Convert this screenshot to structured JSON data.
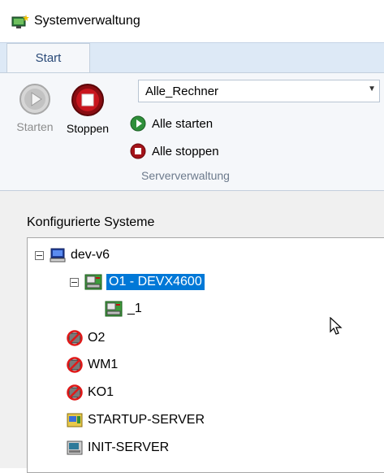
{
  "window": {
    "title": "Systemverwaltung",
    "icon": "monitor-star-icon"
  },
  "ribbon": {
    "tab": "Start",
    "starten_label": "Starten",
    "stoppen_label": "Stoppen",
    "combo_value": "Alle_Rechner",
    "alle_starten_label": "Alle starten",
    "alle_stoppen_label": "Alle stoppen",
    "group_label": "Serververwaltung"
  },
  "panel": {
    "title": "Konfigurierte Systeme",
    "tree": {
      "root": "dev-v6",
      "selected_node": "O1 - DEVX4600",
      "child": "_1",
      "items": [
        "O2",
        "WM1",
        "KO1",
        "STARTUP-SERVER",
        "INIT-SERVER"
      ]
    }
  },
  "colors": {
    "selection": "#0078d7",
    "ribbon_bg": "#f5f7fa",
    "tab_strip": "#dde9f6"
  }
}
